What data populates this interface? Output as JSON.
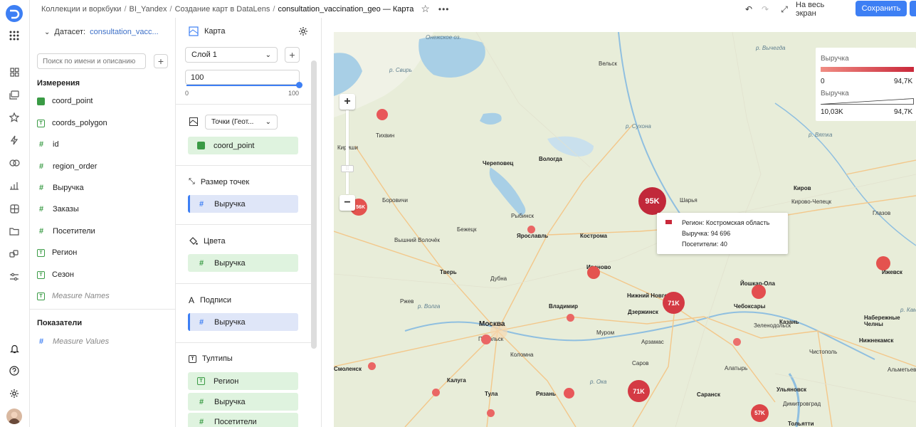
{
  "header": {
    "breadcrumbs": [
      "Коллекции и воркбуки",
      "BI_Yandex",
      "Создание карт в DataLens"
    ],
    "title": "consultation_vaccination_geo — Карта",
    "fullscreen_label": "На весь экран",
    "save_label": "Сохранить"
  },
  "dataset": {
    "label": "Датасет:",
    "name": "consultation_vacc...",
    "search_placeholder": "Поиск по имени и описанию",
    "dimensions_title": "Измерения",
    "dimensions": [
      {
        "name": "coord_point",
        "icon": "geo-icon"
      },
      {
        "name": "coords_polygon",
        "icon": "text-icon"
      },
      {
        "name": "id",
        "icon": "hash-icon"
      },
      {
        "name": "region_order",
        "icon": "hash-icon"
      },
      {
        "name": "Выручка",
        "icon": "hash-icon"
      },
      {
        "name": "Заказы",
        "icon": "hash-icon"
      },
      {
        "name": "Посетители",
        "icon": "hash-icon"
      },
      {
        "name": "Регион",
        "icon": "text-icon"
      },
      {
        "name": "Сезон",
        "icon": "text-icon"
      },
      {
        "name": "Measure Names",
        "icon": "text-icon"
      }
    ],
    "measures_title": "Показатели",
    "measures": [
      {
        "name": "Measure Values",
        "icon": "hash-icon"
      }
    ]
  },
  "visual": {
    "type_label": "Карта",
    "layer": "Слой 1",
    "opacity_value": "100",
    "opacity_min": "0",
    "opacity_max": "100",
    "geo_type": "Точки (Геот...",
    "geo_field": "coord_point",
    "size_title": "Размер точек",
    "size_field": "Выручка",
    "colors_title": "Цвета",
    "colors_field": "Выручка",
    "labels_title": "Подписи",
    "labels_field": "Выручка",
    "tooltips_title": "Тултипы",
    "tooltip_fields": [
      "Регион",
      "Выручка",
      "Посетители"
    ]
  },
  "map": {
    "legend": {
      "color_title": "Выручка",
      "color_min": "0",
      "color_max": "94,7K",
      "size_title": "Выручка",
      "size_min": "10,03K",
      "size_max": "94,7K",
      "gradient_from": "#f08c83",
      "gradient_to": "#c9283a"
    },
    "tooltip": {
      "region": "Регион: Костромская область",
      "revenue": "Выручка: 94 696",
      "visitors": "Посетители: 40",
      "marker_color": "#c9283a"
    },
    "bubble_labels": [
      "95K",
      "71K",
      "71K",
      "57K",
      "56K"
    ],
    "cities": [
      "Онежское оз.",
      "Вельск",
      "Тихвин",
      "Кириши",
      "Вологда",
      "Череповец",
      "Шарья",
      "Киров",
      "Кирово-Чепецк",
      "Глазов",
      "Боровичи",
      "Рыбинск",
      "Бежецк",
      "Ярославль",
      "Кострома",
      "Вышний Волочёк",
      "Тверь",
      "Дубна",
      "Иваново",
      "Ижевск",
      "Йошкар-Ола",
      "Нижний Новгород",
      "Дзержинск",
      "Чебоксары",
      "Владимир",
      "Ржев",
      "Москва",
      "Подольск",
      "Муром",
      "Казань",
      "Набережные Челны",
      "Нижнекамск",
      "Арзамас",
      "Зеленодольск",
      "Смоленск",
      "Коломна",
      "Чистополь",
      "Калуга",
      "Саров",
      "Алатырь",
      "Рязань",
      "Саранск",
      "Ульяновск",
      "Тула",
      "Димитровград",
      "Тольятти",
      "Альметьевск",
      "р. Свирь",
      "р. Сухона",
      "р. Вятка",
      "р. Ока",
      "р. Волга",
      "р. Вычегда",
      "р. Кама"
    ],
    "colors": {
      "bubble": "#e8464b",
      "bubble_dark": "#c1283a"
    }
  }
}
